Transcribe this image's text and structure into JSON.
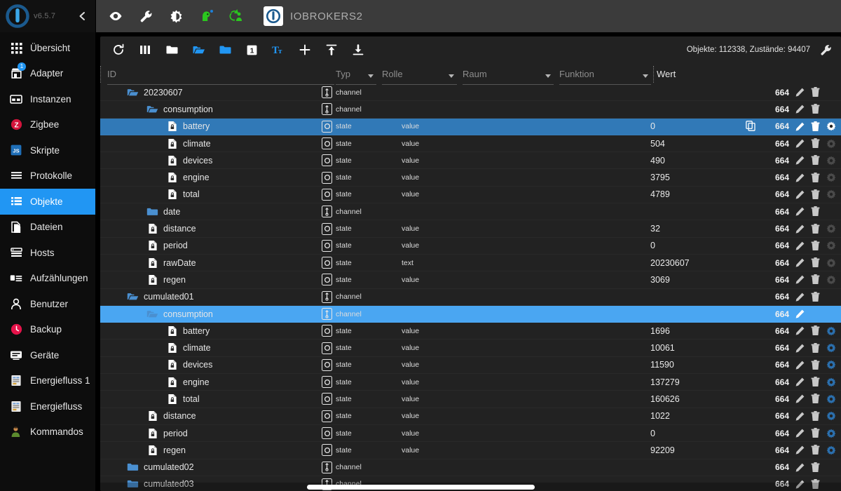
{
  "sidebar": {
    "version": "v6.5.7",
    "logo_icon": "iobroker-logo-icon",
    "collapse_icon": "chevron-left-icon",
    "items": [
      {
        "label": "Übersicht",
        "icon": "grid-dots-icon",
        "active": false
      },
      {
        "label": "Adapter",
        "icon": "store-icon",
        "active": false,
        "badge": "1"
      },
      {
        "label": "Instanzen",
        "icon": "instances-icon",
        "active": false
      },
      {
        "label": "Zigbee",
        "icon": "zigbee-z-icon",
        "active": false
      },
      {
        "label": "Skripte",
        "icon": "javascript-js-icon",
        "active": false
      },
      {
        "label": "Protokolle",
        "icon": "list-lines-icon",
        "active": false
      },
      {
        "label": "Objekte",
        "icon": "objects-list-icon",
        "active": true
      },
      {
        "label": "Dateien",
        "icon": "files-copy-icon",
        "active": false
      },
      {
        "label": "Hosts",
        "icon": "hosts-server-icon",
        "active": false
      },
      {
        "label": "Aufzählungen",
        "icon": "enums-icon",
        "active": false
      },
      {
        "label": "Benutzer",
        "icon": "user-person-icon",
        "active": false
      },
      {
        "label": "Backup",
        "icon": "backup-clock-icon",
        "active": false
      },
      {
        "label": "Geräte",
        "icon": "devices-card-icon",
        "active": false
      },
      {
        "label": "Energiefluss 1",
        "icon": "energyflow-doc-icon",
        "active": false
      },
      {
        "label": "Energiefluss",
        "icon": "energyflow-doc-icon",
        "active": false
      },
      {
        "label": "Kommandos",
        "icon": "commands-person-icon",
        "active": false
      }
    ]
  },
  "topbar": {
    "brand_name": "IOBROKERS2",
    "brand_logo_icon": "iobroker-logo-icon",
    "icons": [
      {
        "name": "eye-icon"
      },
      {
        "name": "wrench-icon"
      },
      {
        "name": "brightness-contrast-icon"
      },
      {
        "name": "green-head-icon",
        "badge": true
      },
      {
        "name": "green-sync-person-icon"
      }
    ]
  },
  "objects_toolbar": {
    "icons": [
      {
        "name": "refresh-icon",
        "color": "#ffffff"
      },
      {
        "name": "columns-icon",
        "color": "#ffffff"
      },
      {
        "name": "folder-closed-icon",
        "color": "#ffffff"
      },
      {
        "name": "folder-open-icon",
        "color": "#2196f3"
      },
      {
        "name": "folder-filled-icon",
        "color": "#2196f3"
      },
      {
        "name": "expand-level-1-icon",
        "color": "#ffffff"
      },
      {
        "name": "text-size-icon",
        "color": "#2196f3"
      },
      {
        "name": "add-icon",
        "color": "#ffffff"
      },
      {
        "name": "upload-icon",
        "color": "#ffffff"
      },
      {
        "name": "download-icon",
        "color": "#ffffff"
      }
    ],
    "stats": "Objekte: 112338, Zustände: 94407",
    "settings_icon": "wrench-icon"
  },
  "columns": {
    "id": "ID",
    "typ": "Typ",
    "rolle": "Rolle",
    "raum": "Raum",
    "funktion": "Funktion",
    "wert": "Wert"
  },
  "colors": {
    "accent": "#2196f3",
    "selected_row": "#3179b7",
    "selected_row_light": "#4aa6f2",
    "panel_bg": "#222222",
    "sidebar_bg": "#0d0d0d",
    "topbar_bg": "#3b3b3b"
  },
  "rows": [
    {
      "name": "20230607",
      "indent": 1,
      "icon": "folder-open-icon",
      "type": "channel",
      "type_icon": "channel-icon",
      "role": "",
      "value": "",
      "acl": "664",
      "actions": [
        "edit-icon",
        "delete-icon"
      ],
      "selected": "none"
    },
    {
      "name": "consumption",
      "indent": 2,
      "icon": "folder-open-icon",
      "type": "channel",
      "type_icon": "channel-icon",
      "role": "",
      "value": "",
      "acl": "664",
      "actions": [
        "edit-icon",
        "delete-icon"
      ],
      "selected": "none"
    },
    {
      "name": "battery",
      "indent": 3,
      "icon": "state-doc-icon",
      "type": "state",
      "type_icon": "state-icon",
      "role": "value",
      "value": "0",
      "acl": "664",
      "actions": [
        "edit-icon",
        "delete-icon",
        "settings-icon"
      ],
      "selected": "dark",
      "copy": true
    },
    {
      "name": "climate",
      "indent": 3,
      "icon": "state-doc-icon",
      "type": "state",
      "type_icon": "state-icon",
      "role": "value",
      "value": "504",
      "acl": "664",
      "actions": [
        "edit-icon",
        "delete-icon",
        "settings-icon"
      ],
      "selected": "none"
    },
    {
      "name": "devices",
      "indent": 3,
      "icon": "state-doc-icon",
      "type": "state",
      "type_icon": "state-icon",
      "role": "value",
      "value": "490",
      "acl": "664",
      "actions": [
        "edit-icon",
        "delete-icon",
        "settings-icon"
      ],
      "selected": "none"
    },
    {
      "name": "engine",
      "indent": 3,
      "icon": "state-doc-icon",
      "type": "state",
      "type_icon": "state-icon",
      "role": "value",
      "value": "3795",
      "acl": "664",
      "actions": [
        "edit-icon",
        "delete-icon",
        "settings-icon"
      ],
      "selected": "none"
    },
    {
      "name": "total",
      "indent": 3,
      "icon": "state-doc-icon",
      "type": "state",
      "type_icon": "state-icon",
      "role": "value",
      "value": "4789",
      "acl": "664",
      "actions": [
        "edit-icon",
        "delete-icon",
        "settings-icon"
      ],
      "selected": "none"
    },
    {
      "name": "date",
      "indent": 2,
      "icon": "folder-closed-blue-icon",
      "type": "channel",
      "type_icon": "channel-icon",
      "role": "",
      "value": "",
      "acl": "664",
      "actions": [
        "edit-icon",
        "delete-icon"
      ],
      "selected": "none"
    },
    {
      "name": "distance",
      "indent": 2,
      "icon": "state-doc-icon",
      "type": "state",
      "type_icon": "state-icon",
      "role": "value",
      "value": "32",
      "acl": "664",
      "actions": [
        "edit-icon",
        "delete-icon",
        "settings-icon"
      ],
      "selected": "none"
    },
    {
      "name": "period",
      "indent": 2,
      "icon": "state-doc-icon",
      "type": "state",
      "type_icon": "state-icon",
      "role": "value",
      "value": "0",
      "acl": "664",
      "actions": [
        "edit-icon",
        "delete-icon",
        "settings-icon"
      ],
      "selected": "none"
    },
    {
      "name": "rawDate",
      "indent": 2,
      "icon": "state-doc-icon",
      "type": "state",
      "type_icon": "state-icon",
      "role": "text",
      "value": "20230607",
      "acl": "664",
      "actions": [
        "edit-icon",
        "delete-icon",
        "settings-icon"
      ],
      "selected": "none"
    },
    {
      "name": "regen",
      "indent": 2,
      "icon": "state-doc-icon",
      "type": "state",
      "type_icon": "state-icon",
      "role": "value",
      "value": "3069",
      "acl": "664",
      "actions": [
        "edit-icon",
        "delete-icon",
        "settings-icon"
      ],
      "selected": "none"
    },
    {
      "name": "cumulated01",
      "indent": 1,
      "icon": "folder-open-icon",
      "type": "channel",
      "type_icon": "channel-icon",
      "role": "",
      "value": "",
      "acl": "664",
      "actions": [
        "edit-icon",
        "delete-icon"
      ],
      "selected": "none"
    },
    {
      "name": "consumption",
      "indent": 2,
      "icon": "folder-open-icon",
      "type": "channel",
      "type_icon": "channel-icon",
      "role": "",
      "value": "",
      "acl": "664",
      "actions": [
        "edit-icon"
      ],
      "selected": "light"
    },
    {
      "name": "battery",
      "indent": 3,
      "icon": "state-doc-icon",
      "type": "state",
      "type_icon": "state-icon",
      "role": "value",
      "value": "1696",
      "acl": "664",
      "actions": [
        "edit-icon",
        "delete-icon",
        "settings-blue-icon"
      ],
      "selected": "none"
    },
    {
      "name": "climate",
      "indent": 3,
      "icon": "state-doc-icon",
      "type": "state",
      "type_icon": "state-icon",
      "role": "value",
      "value": "10061",
      "acl": "664",
      "actions": [
        "edit-icon",
        "delete-icon",
        "settings-blue-icon"
      ],
      "selected": "none"
    },
    {
      "name": "devices",
      "indent": 3,
      "icon": "state-doc-icon",
      "type": "state",
      "type_icon": "state-icon",
      "role": "value",
      "value": "11590",
      "acl": "664",
      "actions": [
        "edit-icon",
        "delete-icon",
        "settings-blue-icon"
      ],
      "selected": "none"
    },
    {
      "name": "engine",
      "indent": 3,
      "icon": "state-doc-icon",
      "type": "state",
      "type_icon": "state-icon",
      "role": "value",
      "value": "137279",
      "acl": "664",
      "actions": [
        "edit-icon",
        "delete-icon",
        "settings-blue-icon"
      ],
      "selected": "none"
    },
    {
      "name": "total",
      "indent": 3,
      "icon": "state-doc-icon",
      "type": "state",
      "type_icon": "state-icon",
      "role": "value",
      "value": "160626",
      "acl": "664",
      "actions": [
        "edit-icon",
        "delete-icon",
        "settings-blue-icon"
      ],
      "selected": "none"
    },
    {
      "name": "distance",
      "indent": 2,
      "icon": "state-doc-icon",
      "type": "state",
      "type_icon": "state-icon",
      "role": "value",
      "value": "1022",
      "acl": "664",
      "actions": [
        "edit-icon",
        "delete-icon",
        "settings-blue-icon"
      ],
      "selected": "none"
    },
    {
      "name": "period",
      "indent": 2,
      "icon": "state-doc-icon",
      "type": "state",
      "type_icon": "state-icon",
      "role": "value",
      "value": "0",
      "acl": "664",
      "actions": [
        "edit-icon",
        "delete-icon",
        "settings-blue-icon"
      ],
      "selected": "none"
    },
    {
      "name": "regen",
      "indent": 2,
      "icon": "state-doc-icon",
      "type": "state",
      "type_icon": "state-icon",
      "role": "value",
      "value": "92209",
      "acl": "664",
      "actions": [
        "edit-icon",
        "delete-icon",
        "settings-blue-icon"
      ],
      "selected": "none"
    },
    {
      "name": "cumulated02",
      "indent": 1,
      "icon": "folder-closed-blue-icon",
      "type": "channel",
      "type_icon": "channel-icon",
      "role": "",
      "value": "",
      "acl": "664",
      "actions": [
        "edit-icon",
        "delete-icon"
      ],
      "selected": "none"
    },
    {
      "name": "cumulated03",
      "indent": 1,
      "icon": "folder-closed-blue-icon",
      "type": "channel",
      "type_icon": "channel-icon",
      "role": "",
      "value": "",
      "acl": "664",
      "actions": [
        "edit-icon",
        "delete-icon"
      ],
      "selected": "none"
    }
  ]
}
